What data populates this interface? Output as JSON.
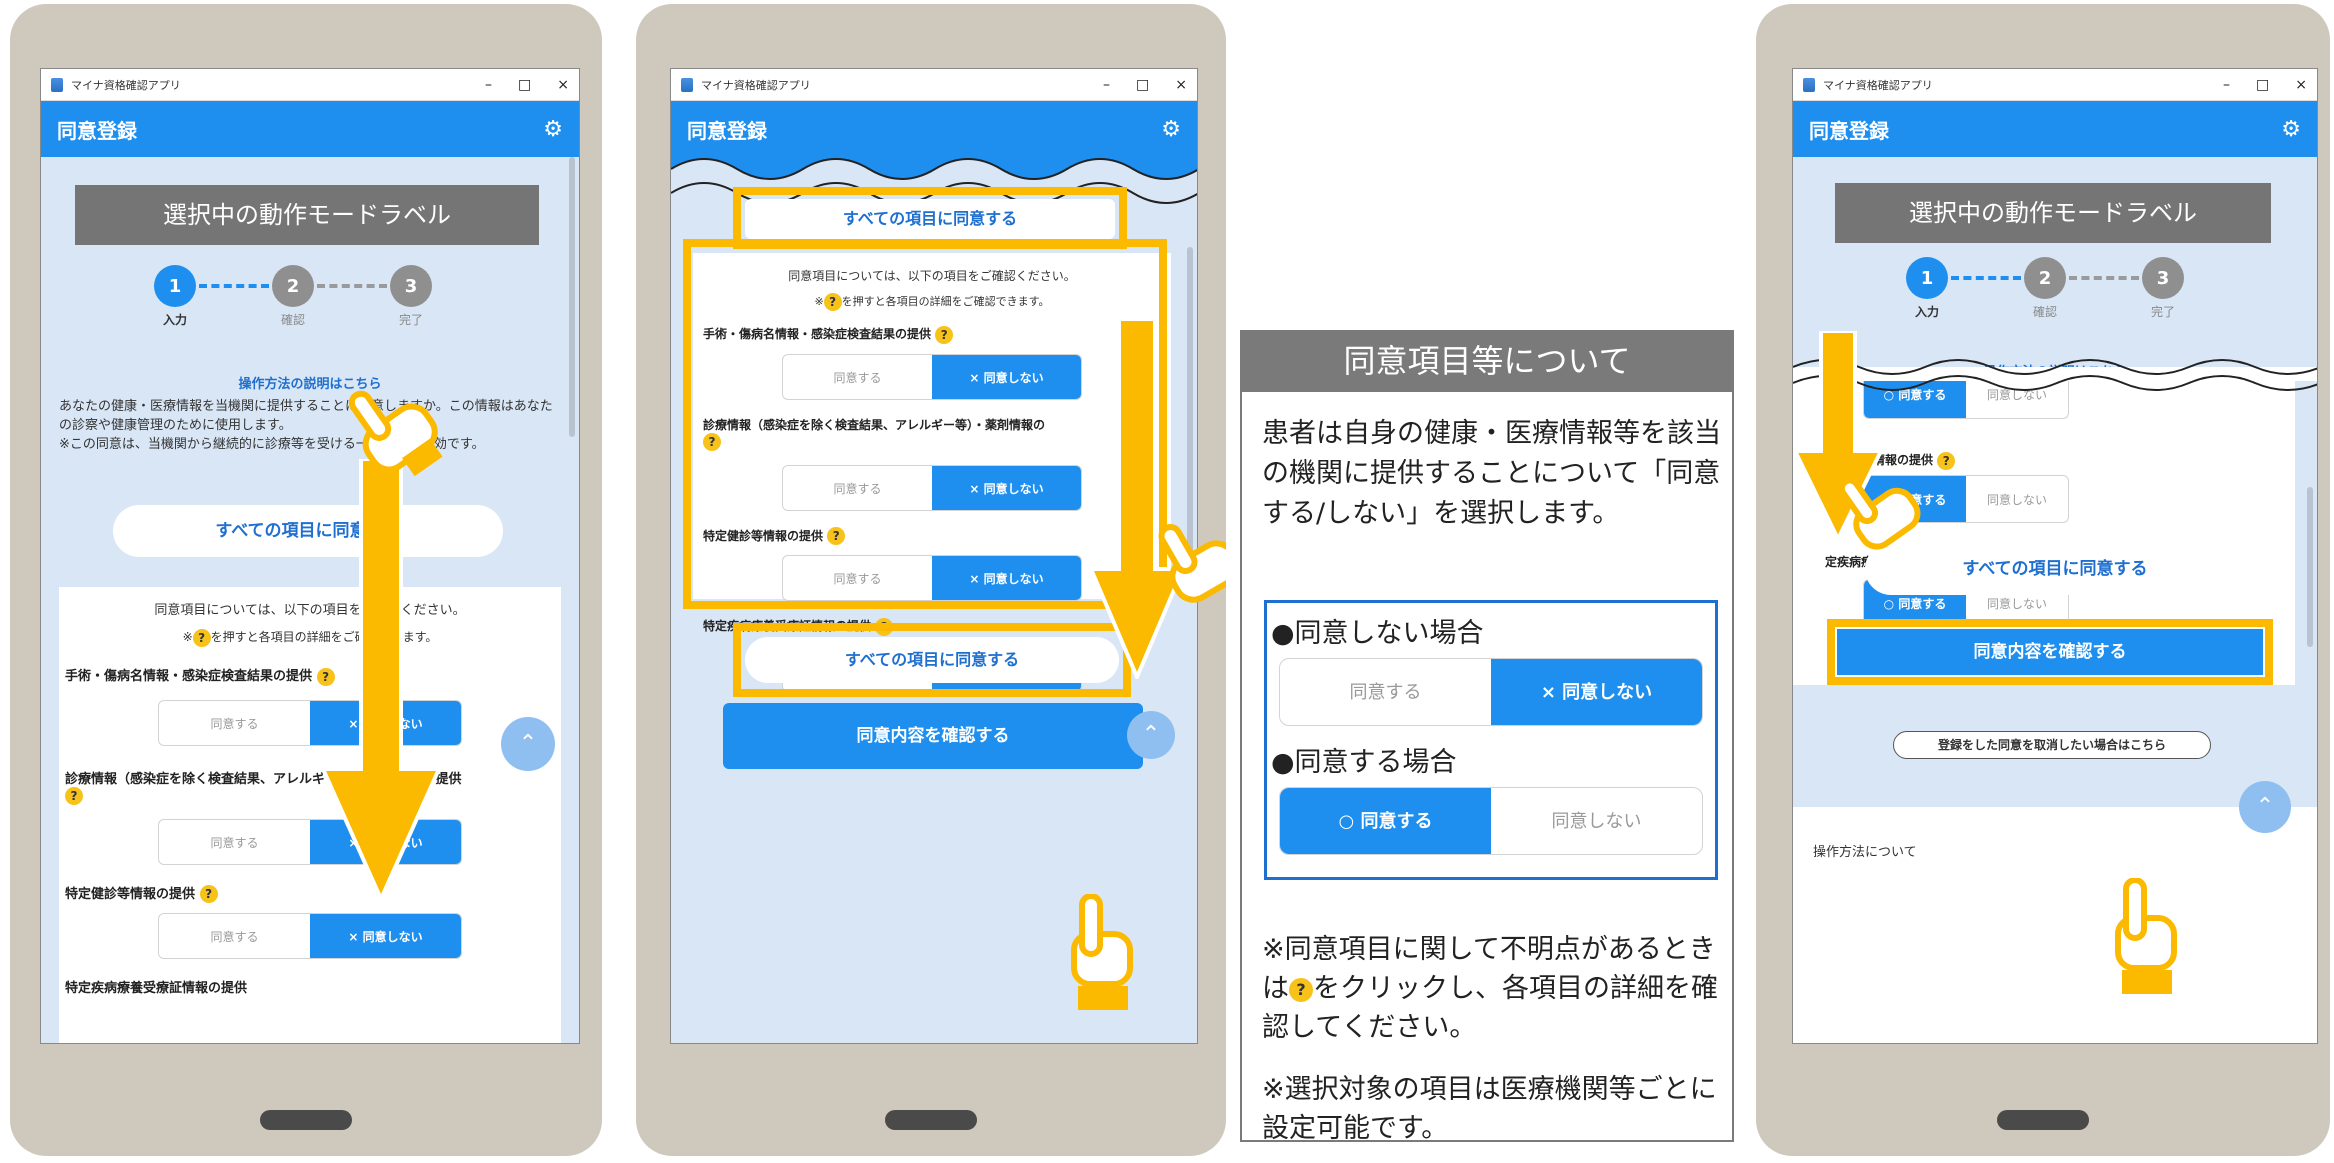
{
  "app": {
    "window_title": "マイナ資格確認アプリ",
    "screen_title": "同意登録",
    "window_controls": [
      "–",
      "□",
      "×"
    ]
  },
  "common": {
    "mode_label": "選択中の動作モードラベル",
    "steps": [
      {
        "num": "1",
        "label": "入力"
      },
      {
        "num": "2",
        "label": "確認"
      },
      {
        "num": "3",
        "label": "完了"
      }
    ],
    "howto_link": "操作方法の説明はこちら",
    "intro_text": "あなたの健康・医療情報を当機関に提供することに同意しますか。この情報はあなたの診察や健康管理のために使用します。\n※この同意は、当機関から継続的に診療等を受ける一定期間、有効です。",
    "agree_all": "すべての項目に同意する",
    "card_note1": "同意項目については、以下の項目をご確認ください。",
    "card_note2_pre": "※",
    "card_note2_post": "を押すと各項目の詳細をご確認できます。",
    "agree": "同意する",
    "disagree": "× 同意しない",
    "disagree_plain": "同意しない",
    "agree_on": "○ 同意する",
    "items": [
      "手術・傷病名情報・感染症検査結果の提供",
      "診療情報（感染症を除く検査結果、アレルギー等）・薬剤情報の提供",
      "特定健診等情報の提供",
      "特定疾病療養受療証情報の提供"
    ],
    "item2_short": "診療情報（感染症を除く検査結果、アレルギー等）・薬剤情報の",
    "item_cut": "特定疾病療養受療証情報の提供",
    "confirm": "同意内容を確認する",
    "cancel_link": "登録をした同意を取消したい場合はこちら",
    "howto_footer": "操作方法について",
    "p3_item_frag1": "定健診等情報の提供",
    "p3_item_frag2": "定疾病療養受療証情報の提供"
  },
  "info": {
    "title": "同意項目等について",
    "desc": "患者は自身の健康・医療情報等を該当の機関に提供することについて「同意する/しない」を選択します。",
    "not_agree_case": "●同意しない場合",
    "agree_case": "●同意する場合",
    "note": "※同意項目に関して不明点があるときは",
    "note2": "をクリックし、各項目の詳細を確認してください。",
    "note3": "※選択対象の項目は医療機関等ごとに設定可能です。"
  },
  "colors": {
    "accent": "#1e8fef",
    "highlight": "#fbba00",
    "help_icon": "#f7c21a",
    "phone": "#cfc8bd"
  }
}
